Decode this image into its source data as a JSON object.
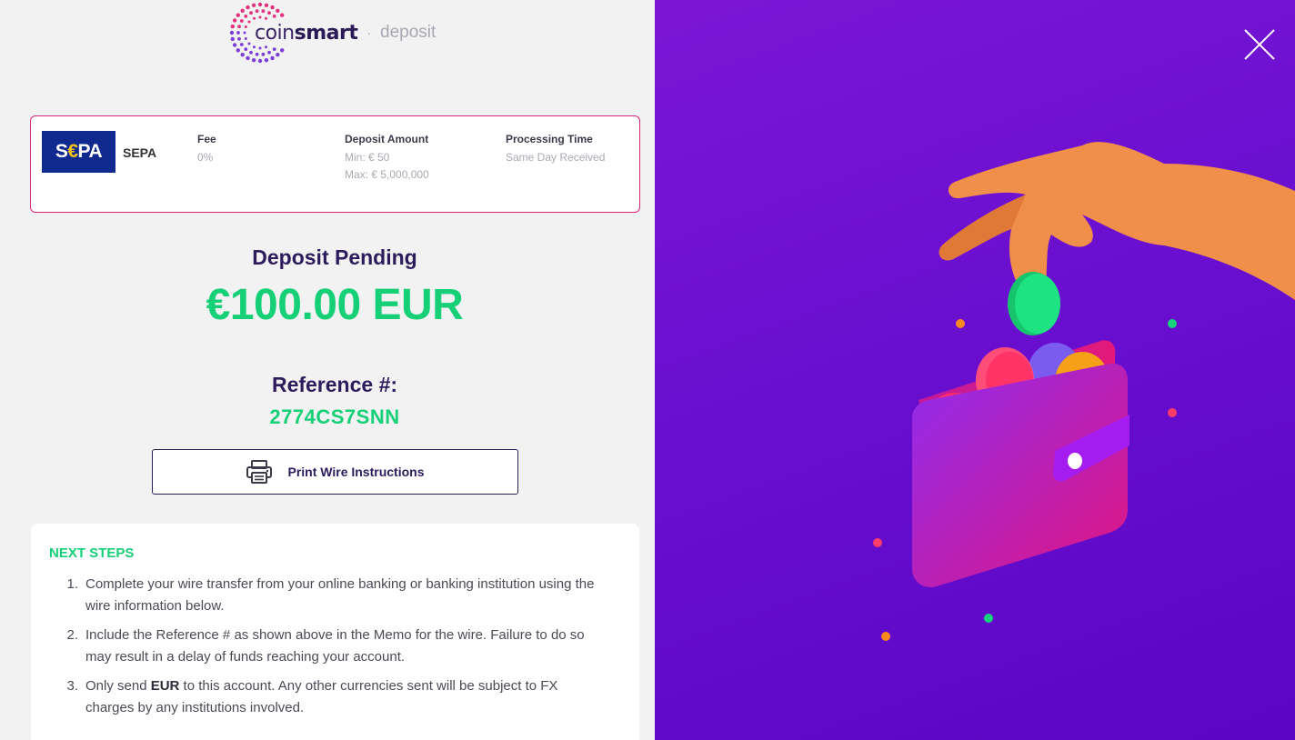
{
  "header": {
    "logo_coin": "coin",
    "logo_smart": "smart",
    "separator": "·",
    "subtitle": "deposit"
  },
  "method": {
    "badge_s": "S",
    "badge_euro": "€",
    "badge_pa": "PA",
    "name": "SEPA",
    "fee_label": "Fee",
    "fee_value": "0%",
    "deposit_label": "Deposit Amount",
    "deposit_min": "Min: € 50",
    "deposit_max": "Max: € 5,000,000",
    "processing_label": "Processing Time",
    "processing_value": "Same Day Received"
  },
  "status": {
    "title": "Deposit Pending",
    "amount": "€100.00 EUR",
    "reference_label": "Reference #:",
    "reference_value": "2774CS7SNN"
  },
  "actions": {
    "print_label": "Print Wire Instructions"
  },
  "next_steps": {
    "title": "NEXT STEPS",
    "items": [
      {
        "num": "1.",
        "text": "Complete your wire transfer from your online banking or banking institution using the wire information below."
      },
      {
        "num": "2.",
        "text": "Include the Reference # as shown above in the Memo for the wire. Failure to do so may result in a delay of funds reaching your account."
      },
      {
        "num": "3.",
        "text_pre": "Only send ",
        "text_bold": "EUR",
        "text_post": " to this account. Any other currencies sent will be subject to FX charges by any institutions involved."
      }
    ]
  },
  "icons": {
    "logo": "coinsmart-dots-icon",
    "print": "printer-icon",
    "close": "close-icon"
  },
  "colors": {
    "accent_green": "#16d078",
    "navy": "#2d1c5c",
    "card_border": "#d4267c",
    "purple_bg": "#6a0fd0"
  }
}
